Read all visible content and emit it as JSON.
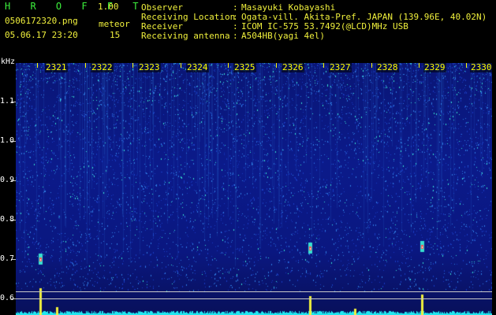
{
  "app": {
    "title": "H R O F F T",
    "version": "1.00"
  },
  "file": {
    "name": "0506172320.png",
    "timestamp": "05.06.17 23:20"
  },
  "meteor": {
    "label": "meteor",
    "count": "15"
  },
  "station_info": [
    {
      "label": "Observer",
      "value": "Masayuki Kobayashi"
    },
    {
      "label": "Receiving Location",
      "value": "Ogata-vill. Akita-Pref. JAPAN (139.96E, 40.02N)"
    },
    {
      "label": "Receiver",
      "value": "ICOM IC-575 53.7492(@LCD)MHz USB"
    },
    {
      "label": "Receiving antenna",
      "value": "A504HB(yagi 4el)"
    }
  ],
  "separator": ":",
  "spectrogram": {
    "y_unit": "kHz",
    "y_ticks": [
      "1.1",
      "1.0",
      "0.9",
      "0.8",
      "0.7",
      "0.6"
    ],
    "x_ticks": [
      "2321",
      "2322",
      "2323",
      "2324",
      "2325",
      "2326",
      "2327",
      "2328",
      "2329",
      "2330"
    ]
  },
  "colors": {
    "background": "#000000",
    "header_text": "#3cf03c",
    "version_text": "#f0f03c",
    "time_labels": "#ffff00",
    "spectrum_low": "#0b1a8a",
    "spectrum_mid": "#2f7be0",
    "spectrum_high": "#38e0d0",
    "meteor_echo": "#ff5050",
    "signal_trace": "#20e8f0"
  }
}
